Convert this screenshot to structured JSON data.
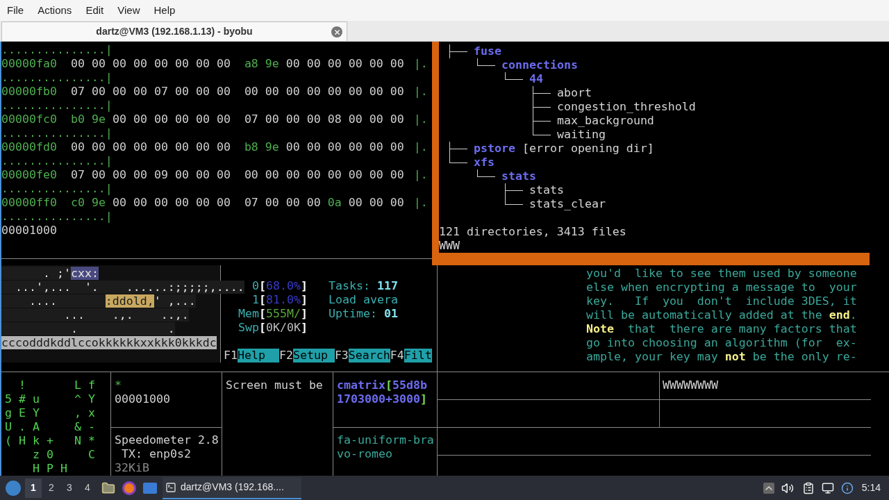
{
  "menu": [
    "File",
    "Actions",
    "Edit",
    "View",
    "Help"
  ],
  "tab": {
    "title": "dartz@VM3 (192.168.1.13) - byobu",
    "selected": true
  },
  "hexdump": {
    "lines": [
      {
        "kind": "ascii",
        "text": "...............|"
      },
      {
        "kind": "row",
        "offset": "00000fa0",
        "ascii": "|.",
        "bytes": [
          {
            "text": "00",
            "highlighted": false
          },
          {
            "text": "00",
            "highlighted": false
          },
          {
            "text": "00",
            "highlighted": false
          },
          {
            "text": "00",
            "highlighted": false
          },
          {
            "text": "00",
            "highlighted": false
          },
          {
            "text": "00",
            "highlighted": false
          },
          {
            "text": "00",
            "highlighted": false
          },
          {
            "text": "00",
            "highlighted": false
          },
          {
            "text": "a8",
            "highlighted": true
          },
          {
            "text": "9e",
            "highlighted": true
          },
          {
            "text": "00",
            "highlighted": false
          },
          {
            "text": "00",
            "highlighted": false
          },
          {
            "text": "00",
            "highlighted": false
          },
          {
            "text": "00",
            "highlighted": false
          },
          {
            "text": "00",
            "highlighted": false
          },
          {
            "text": "00",
            "highlighted": false
          }
        ]
      },
      {
        "kind": "ascii",
        "text": "...............|"
      },
      {
        "kind": "row",
        "offset": "00000fb0",
        "ascii": "|.",
        "bytes": [
          {
            "text": "07",
            "highlighted": false
          },
          {
            "text": "00",
            "highlighted": false
          },
          {
            "text": "00",
            "highlighted": false
          },
          {
            "text": "00",
            "highlighted": false
          },
          {
            "text": "07",
            "highlighted": false
          },
          {
            "text": "00",
            "highlighted": false
          },
          {
            "text": "00",
            "highlighted": false
          },
          {
            "text": "00",
            "highlighted": false
          },
          {
            "text": "00",
            "highlighted": false
          },
          {
            "text": "00",
            "highlighted": false
          },
          {
            "text": "00",
            "highlighted": false
          },
          {
            "text": "00",
            "highlighted": false
          },
          {
            "text": "00",
            "highlighted": false
          },
          {
            "text": "00",
            "highlighted": false
          },
          {
            "text": "00",
            "highlighted": false
          },
          {
            "text": "00",
            "highlighted": false
          }
        ]
      },
      {
        "kind": "ascii",
        "text": "...............|"
      },
      {
        "kind": "row",
        "offset": "00000fc0",
        "ascii": "|.",
        "bytes": [
          {
            "text": "b0",
            "highlighted": true
          },
          {
            "text": "9e",
            "highlighted": true
          },
          {
            "text": "00",
            "highlighted": false
          },
          {
            "text": "00",
            "highlighted": false
          },
          {
            "text": "00",
            "highlighted": false
          },
          {
            "text": "00",
            "highlighted": false
          },
          {
            "text": "00",
            "highlighted": false
          },
          {
            "text": "00",
            "highlighted": false
          },
          {
            "text": "07",
            "highlighted": false
          },
          {
            "text": "00",
            "highlighted": false
          },
          {
            "text": "00",
            "highlighted": false
          },
          {
            "text": "00",
            "highlighted": false
          },
          {
            "text": "08",
            "highlighted": false
          },
          {
            "text": "00",
            "highlighted": false
          },
          {
            "text": "00",
            "highlighted": false
          },
          {
            "text": "00",
            "highlighted": false
          }
        ]
      },
      {
        "kind": "ascii",
        "text": "...............|"
      },
      {
        "kind": "row",
        "offset": "00000fd0",
        "ascii": "|.",
        "bytes": [
          {
            "text": "00",
            "highlighted": false
          },
          {
            "text": "00",
            "highlighted": false
          },
          {
            "text": "00",
            "highlighted": false
          },
          {
            "text": "00",
            "highlighted": false
          },
          {
            "text": "00",
            "highlighted": false
          },
          {
            "text": "00",
            "highlighted": false
          },
          {
            "text": "00",
            "highlighted": false
          },
          {
            "text": "00",
            "highlighted": false
          },
          {
            "text": "b8",
            "highlighted": true
          },
          {
            "text": "9e",
            "highlighted": true
          },
          {
            "text": "00",
            "highlighted": false
          },
          {
            "text": "00",
            "highlighted": false
          },
          {
            "text": "00",
            "highlighted": false
          },
          {
            "text": "00",
            "highlighted": false
          },
          {
            "text": "00",
            "highlighted": false
          },
          {
            "text": "00",
            "highlighted": false
          }
        ]
      },
      {
        "kind": "ascii",
        "text": "...............|"
      },
      {
        "kind": "row",
        "offset": "00000fe0",
        "ascii": "|.",
        "bytes": [
          {
            "text": "07",
            "highlighted": false
          },
          {
            "text": "00",
            "highlighted": false
          },
          {
            "text": "00",
            "highlighted": false
          },
          {
            "text": "00",
            "highlighted": false
          },
          {
            "text": "09",
            "highlighted": false
          },
          {
            "text": "00",
            "highlighted": false
          },
          {
            "text": "00",
            "highlighted": false
          },
          {
            "text": "00",
            "highlighted": false
          },
          {
            "text": "00",
            "highlighted": false
          },
          {
            "text": "00",
            "highlighted": false
          },
          {
            "text": "00",
            "highlighted": false
          },
          {
            "text": "00",
            "highlighted": false
          },
          {
            "text": "00",
            "highlighted": false
          },
          {
            "text": "00",
            "highlighted": false
          },
          {
            "text": "00",
            "highlighted": false
          },
          {
            "text": "00",
            "highlighted": false
          }
        ]
      },
      {
        "kind": "ascii",
        "text": "...............|"
      },
      {
        "kind": "row",
        "offset": "00000ff0",
        "ascii": "|.",
        "bytes": [
          {
            "text": "c0",
            "highlighted": true
          },
          {
            "text": "9e",
            "highlighted": true
          },
          {
            "text": "00",
            "highlighted": false
          },
          {
            "text": "00",
            "highlighted": false
          },
          {
            "text": "00",
            "highlighted": false
          },
          {
            "text": "00",
            "highlighted": false
          },
          {
            "text": "00",
            "highlighted": false
          },
          {
            "text": "00",
            "highlighted": false
          },
          {
            "text": "07",
            "highlighted": false
          },
          {
            "text": "00",
            "highlighted": false
          },
          {
            "text": "00",
            "highlighted": false
          },
          {
            "text": "00",
            "highlighted": false
          },
          {
            "text": "0a",
            "highlighted": true
          },
          {
            "text": "00",
            "highlighted": false
          },
          {
            "text": "00",
            "highlighted": false
          },
          {
            "text": "00",
            "highlighted": false
          }
        ]
      },
      {
        "kind": "ascii",
        "text": "...............|"
      }
    ],
    "end": "00001000"
  },
  "tree": {
    "items": [
      {
        "name": "fuse",
        "dir": true,
        "children": [
          {
            "name": "connections",
            "dir": true,
            "children": [
              {
                "name": "44",
                "dir": true,
                "children": [
                  {
                    "name": "abort",
                    "dir": false
                  },
                  {
                    "name": "congestion_threshold",
                    "dir": false
                  },
                  {
                    "name": "max_background",
                    "dir": false
                  },
                  {
                    "name": "waiting",
                    "dir": false
                  }
                ]
              }
            ]
          }
        ]
      },
      {
        "name": "pstore",
        "dir": true,
        "note": "[error opening dir]"
      },
      {
        "name": "xfs",
        "dir": true,
        "children": [
          {
            "name": "stats",
            "dir": true,
            "children": [
              {
                "name": "stats",
                "dir": false
              },
              {
                "name": "stats_clear",
                "dir": false
              }
            ]
          }
        ]
      }
    ],
    "summary": "121 directories, 3413 files",
    "prompt": "WWW"
  },
  "ascii_art": [
    [
      {
        "text": "      . ;'",
        "color": "#1c1c1c"
      },
      {
        "text": "cxx:",
        "color": "#4a4a80"
      }
    ],
    [
      {
        "text": "  ...',...  '.    ......:;;;;;,....",
        "color": "#1c1c1c"
      }
    ],
    [
      {
        "text": "    ....       ",
        "color": "#1c1c1c"
      },
      {
        "text": ":ddold,",
        "color": "#c8a860"
      },
      {
        "text": "' ,...",
        "color": "#1c1c1c"
      }
    ],
    [
      {
        "text": "         ...    .,.    ..,.",
        "color": "#1c1c1c"
      }
    ],
    [
      {
        "text": "          .             .",
        "color": "#1c1c1c"
      }
    ],
    [
      {
        "text": "cccodddkddlccokkkkkkxxkkk0kkkdc",
        "color": "#b4b4b4"
      }
    ]
  ],
  "htop": {
    "meters": [
      {
        "kind": "cpu",
        "label": "0",
        "open": "[",
        "reading": "68.0%",
        "close": "]"
      },
      {
        "kind": "cpu",
        "label": "1",
        "open": "[",
        "reading": "81.0%",
        "close": "]"
      },
      {
        "kind": "mem",
        "label": "Mem",
        "open": "[",
        "reading": "555M/",
        "close": "]"
      },
      {
        "kind": "swap",
        "label": "Swp",
        "open": "[",
        "reading": "0K/0K",
        "close": "]"
      }
    ],
    "stats": [
      {
        "label": "Tasks: ",
        "value": "117"
      },
      {
        "label": "Load avera"
      },
      {
        "label": "Uptime: ",
        "value": "01"
      }
    ],
    "keys": [
      {
        "key": "F1",
        "label": "Help  "
      },
      {
        "key": "F2",
        "label": "Setup "
      },
      {
        "key": "F3",
        "label": "Search"
      },
      {
        "key": "F4",
        "label": "Filt"
      }
    ]
  },
  "man_text": [
    "you'd  like to see them used by someone",
    "else when encrypting a message to  your",
    "key.   If  you  don't  include 3DES, it",
    "will be automatically added at the **end**.",
    "**Note**  that  there are many factors that",
    "go into choosing an algorithm (for  ex-",
    "ample, your key may **not** be the only re-"
  ],
  "matrix": [
    " !   Lf",
    "5#u  ^Y",
    "gEY  ,x",
    "U.A  &-",
    "(Hk+ N*",
    "  z0  C",
    "  HPH  "
  ],
  "hex_cell": {
    "mark": "*",
    "text": "00001000"
  },
  "speed_cell": [
    "Speedometer 2.8",
    " TX: enp0s2",
    "32KiB"
  ],
  "screen_cell": "Screen must be",
  "cmatrix_cell": [
    [
      {
        "text": "cmatrix",
        "kind": "name"
      },
      {
        "text": "[",
        "kind": "bracket"
      },
      {
        "text": "55d8b",
        "kind": "name"
      }
    ],
    [
      {
        "text": "1703000+3000",
        "kind": "name"
      },
      {
        "text": "]",
        "kind": "bracket"
      }
    ]
  ],
  "host_cell": [
    "fa-uniform-bra",
    "vo-romeo"
  ],
  "grid_cell": "WWWWWWWW",
  "taskbar": {
    "workspaces": [
      {
        "label": "1",
        "selected": true
      },
      {
        "label": "2",
        "selected": false
      },
      {
        "label": "3",
        "selected": false
      },
      {
        "label": "4",
        "selected": false
      }
    ],
    "task": {
      "title": "dartz@VM3 (192.168....",
      "selected": true
    },
    "clock": "5:14"
  }
}
